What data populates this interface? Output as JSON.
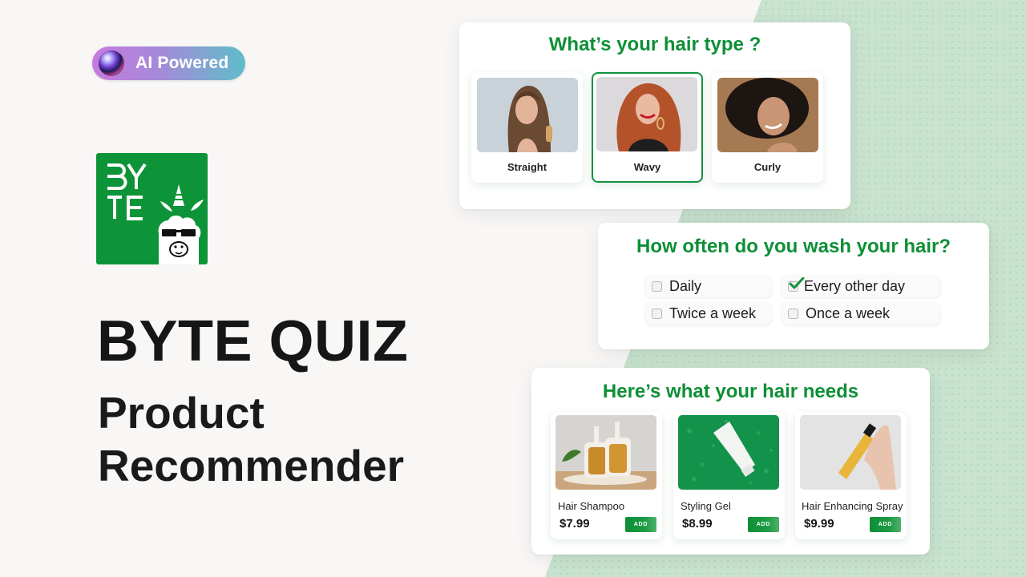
{
  "badge": {
    "label": "AI Powered",
    "icon": "gradient-orb-icon"
  },
  "logo": {
    "text_line1": "BY",
    "text_line2": "TE",
    "mascot": "unicorn-llama-with-sunglasses",
    "brand_color": "#0e9438"
  },
  "headline": {
    "title": "BYTE QUIZ",
    "subtitle_line1": "Product",
    "subtitle_line2": "Recommender"
  },
  "colors": {
    "accent_green": "#0e8f36",
    "background_light": "#f8f7f6",
    "background_green": "#c8e3cf"
  },
  "hair_type_card": {
    "question": "What’s your hair type ?",
    "options": [
      {
        "label": "Straight",
        "selected": false,
        "image": "woman-straight-brown-hair-photo"
      },
      {
        "label": "Wavy",
        "selected": true,
        "image": "woman-wavy-red-hair-photo"
      },
      {
        "label": "Curly",
        "selected": false,
        "image": "woman-curly-black-hair-photo"
      }
    ]
  },
  "wash_card": {
    "question": "How often do you wash your hair?",
    "options": [
      {
        "label": "Daily",
        "checked": false
      },
      {
        "label": "Every other day",
        "checked": true
      },
      {
        "label": "Twice a week",
        "checked": false
      },
      {
        "label": "Once a week",
        "checked": false
      }
    ]
  },
  "products_card": {
    "title": "Here’s what your hair needs",
    "add_label": "ADD",
    "products": [
      {
        "name": "Hair Shampoo",
        "price": "$7.99",
        "image": "shampoo-pump-bottles-photo"
      },
      {
        "name": "Styling Gel",
        "price": "$8.99",
        "image": "white-tube-on-green-photo"
      },
      {
        "name": "Hair Enhancing Spray",
        "price": "$9.99",
        "image": "hand-holding-spray-bottle-photo"
      }
    ]
  }
}
